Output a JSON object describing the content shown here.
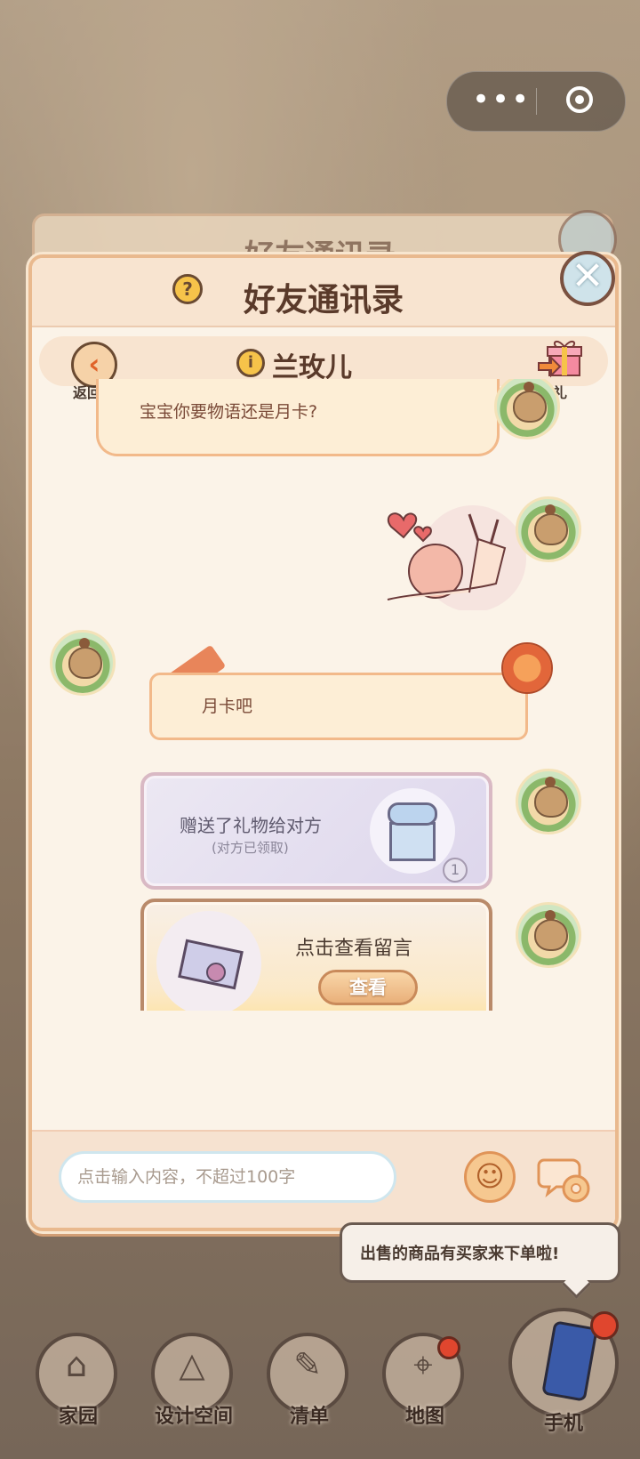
{
  "dialog": {
    "ghost_title": "好友通讯录",
    "title": "好友通讯录",
    "help_icon": "?",
    "close_icon": "✕",
    "back_label": "返回",
    "friend_name": "兰玫儿",
    "info_icon": "i",
    "gift_label": "赠礼"
  },
  "messages": {
    "m1_text": "宝宝你要物语还是月卡?",
    "m2_text": "月卡吧",
    "gift_card": {
      "title": "赠送了礼物给对方",
      "subtitle": "(对方已领取)",
      "count": "1"
    },
    "message_card": {
      "title": "点击查看留言",
      "button": "查看"
    }
  },
  "input": {
    "placeholder": "点击输入内容，不超过100字",
    "value": ""
  },
  "notification": {
    "text": "出售的商品有买家来下单啦!"
  },
  "nav": {
    "home": "家园",
    "design": "设计空间",
    "list": "清单",
    "map": "地图",
    "phone": "手机"
  },
  "colors": {
    "accent": "#e9b98e",
    "title_text": "#5a3a2a",
    "badge_red": "#e0462e"
  }
}
